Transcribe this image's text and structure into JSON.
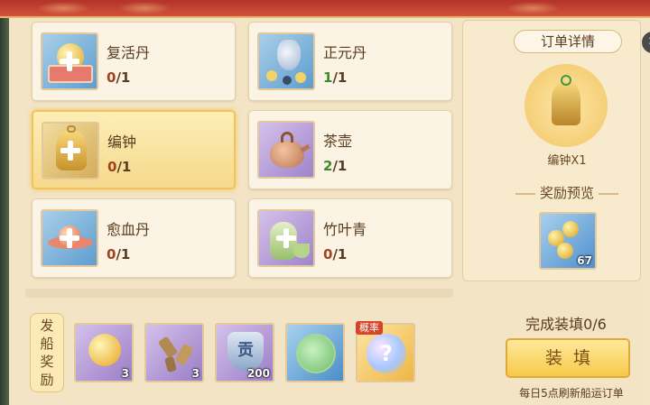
{
  "orders": [
    {
      "name": "复活丹",
      "have": "0",
      "total": "/1",
      "complete": false,
      "icon": "pill-box-icon"
    },
    {
      "name": "正元丹",
      "have": "1",
      "total": "/1",
      "complete": true,
      "icon": "gourd-pills-icon"
    },
    {
      "name": "编钟",
      "have": "0",
      "total": "/1",
      "complete": false,
      "icon": "bronze-bell-icon"
    },
    {
      "name": "茶壶",
      "have": "2",
      "total": "/1",
      "complete": true,
      "icon": "teapot-icon"
    },
    {
      "name": "愈血丹",
      "have": "0",
      "total": "/1",
      "complete": false,
      "icon": "pill-dish-icon"
    },
    {
      "name": "竹叶青",
      "have": "0",
      "total": "/1",
      "complete": false,
      "icon": "wine-bottle-icon"
    }
  ],
  "detail": {
    "title": "订单详情",
    "close_glyph": "✕",
    "item_label": "编钟X1",
    "reward_title": "奖励预览",
    "reward_qty": "67"
  },
  "ship_reward": {
    "label_chars": [
      "发",
      "船",
      "奖",
      "励"
    ],
    "items": [
      {
        "qty": "3",
        "icon": "gold-orb-icon"
      },
      {
        "qty": "3",
        "icon": "crystal-shards-icon"
      },
      {
        "qty": "200",
        "icon": "contribution-badge-icon",
        "glyph": "贡"
      },
      {
        "qty": "",
        "icon": "jade-bear-coin-icon"
      },
      {
        "qty": "",
        "icon": "mystery-orb-icon",
        "badge": "概率",
        "glyph": "?"
      }
    ]
  },
  "status": {
    "complete_text": "完成装填0/6",
    "load_button": "装填",
    "refresh_note": "每日5点刷新船运订单"
  },
  "colors": {
    "accent_gold": "#f7c948",
    "have_ok": "#3c8a2c",
    "have_missing": "#a0421f"
  }
}
